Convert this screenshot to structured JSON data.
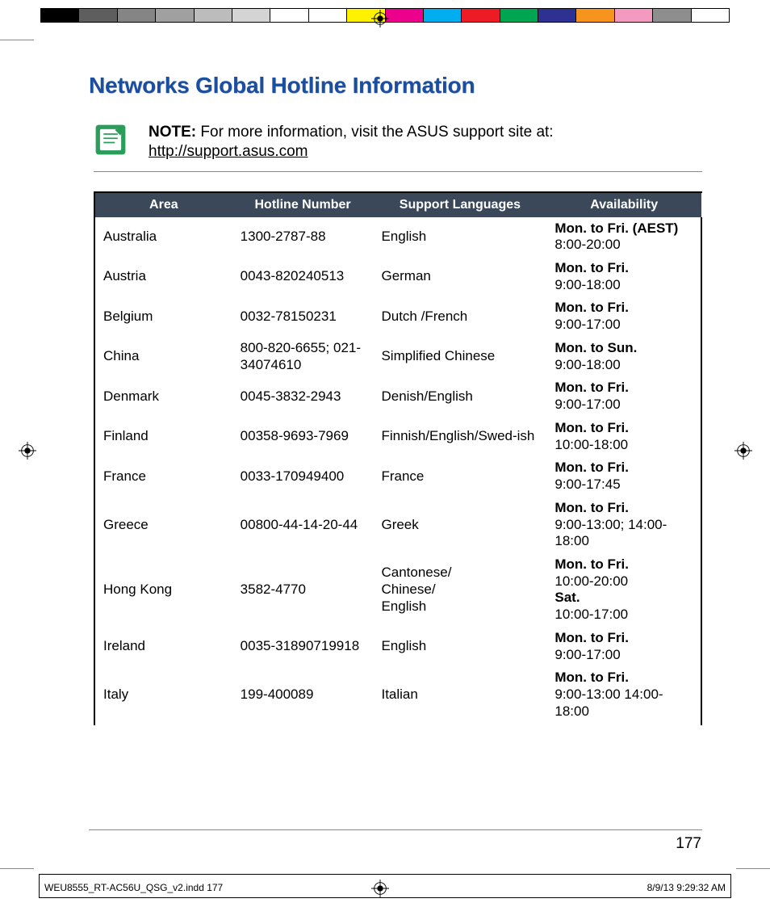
{
  "title": "Networks Global Hotline Information",
  "note": {
    "label": "NOTE:",
    "text": "For more information, visit the ASUS support site at:",
    "link": "http://support.asus.com"
  },
  "table": {
    "headers": [
      "Area",
      "Hotline Number",
      "Support Languages",
      "Availability"
    ],
    "rows": [
      {
        "area": "Australia",
        "number": "1300-2787-88",
        "languages": "English",
        "availability": [
          {
            "days": "Mon. to Fri. (AEST)",
            "hours": "8:00-20:00"
          }
        ]
      },
      {
        "area": "Austria",
        "number": "0043-820240513",
        "languages": "German",
        "availability": [
          {
            "days": "Mon. to Fri.",
            "hours": "9:00-18:00"
          }
        ]
      },
      {
        "area": "Belgium",
        "number": "0032-78150231",
        "languages": "Dutch /French",
        "availability": [
          {
            "days": "Mon. to Fri.",
            "hours": "9:00-17:00"
          }
        ]
      },
      {
        "area": "China",
        "number": "800-820-6655; 021-34074610",
        "languages": "Simplified Chinese",
        "availability": [
          {
            "days": "Mon. to Sun.",
            "hours": "9:00-18:00"
          }
        ]
      },
      {
        "area": "Denmark",
        "number": "0045-3832-2943",
        "languages": "Denish/English",
        "availability": [
          {
            "days": "Mon. to Fri.",
            "hours": "9:00-17:00"
          }
        ]
      },
      {
        "area": "Finland",
        "number": "00358-9693-7969",
        "languages": "Finnish/English/Swed-ish",
        "availability": [
          {
            "days": "Mon. to Fri.",
            "hours": "10:00-18:00"
          }
        ]
      },
      {
        "area": "France",
        "number": "0033-170949400",
        "languages": "France",
        "availability": [
          {
            "days": "Mon. to Fri.",
            "hours": "9:00-17:45"
          }
        ]
      },
      {
        "area": "Greece",
        "number": "00800-44-14-20-44",
        "languages": "Greek",
        "availability": [
          {
            "days": "Mon. to Fri.",
            "hours": "9:00-13:00; 14:00-18:00"
          }
        ]
      },
      {
        "area": "Hong Kong",
        "number": "3582-4770",
        "languages": "Cantonese/\nChinese/\nEnglish",
        "availability": [
          {
            "days": "Mon. to Fri.",
            "hours": "10:00-20:00"
          },
          {
            "days": "Sat.",
            "hours": "10:00-17:00"
          }
        ]
      },
      {
        "area": "Ireland",
        "number": "0035-31890719918",
        "languages": "English",
        "availability": [
          {
            "days": "Mon. to Fri.",
            "hours": "9:00-17:00"
          }
        ]
      },
      {
        "area": "Italy",
        "number": "199-400089",
        "languages": "Italian",
        "availability": [
          {
            "days": "Mon. to Fri.",
            "hours": "9:00-13:00 14:00- 18:00"
          }
        ]
      }
    ]
  },
  "page_number": "177",
  "slug": {
    "filename": "WEU8555_RT-AC56U_QSG_v2.indd   177",
    "timestamp": "8/9/13   9:29:32 AM"
  },
  "printbar_colors": [
    "#000000",
    "#5e5e5e",
    "#858585",
    "#a0a0a0",
    "#bcbcbc",
    "#d4d4d4",
    "#ffffff",
    "#ffffff",
    "#fff200",
    "#ec008c",
    "#00adee",
    "#ed1c24",
    "#00a551",
    "#2e3192",
    "#f7941d",
    "#f49ac1",
    "#8e8e8e",
    "#ffffff"
  ]
}
